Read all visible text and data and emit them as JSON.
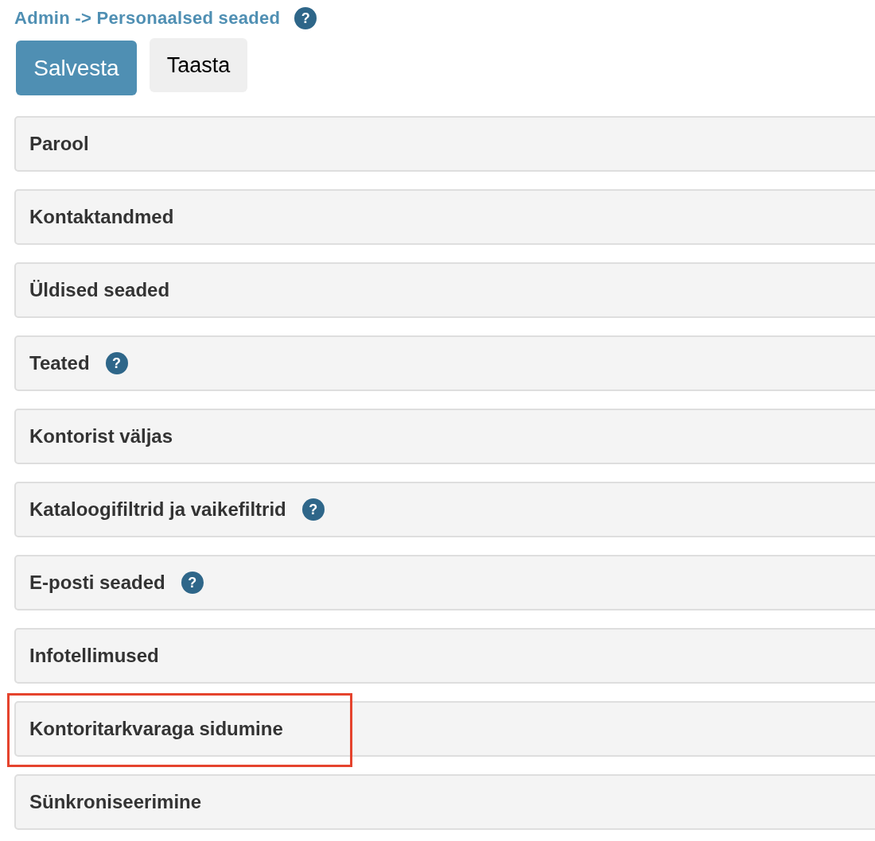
{
  "breadcrumb": {
    "text": "Admin -> Personaalsed seaded",
    "help_icon": "?"
  },
  "buttons": [
    {
      "label": "Salvesta",
      "kind": "primary"
    },
    {
      "label": "Taasta",
      "kind": "secondary"
    }
  ],
  "sections": [
    {
      "title": "Parool",
      "highlighted": false
    },
    {
      "title": "Kontaktandmed",
      "highlighted": false
    },
    {
      "title": "Üldised seaded",
      "highlighted": false
    },
    {
      "title": "Teated",
      "help_icon": "?",
      "highlighted": false
    },
    {
      "title": "Kontorist väljas",
      "highlighted": false
    },
    {
      "title": "Kataloogifiltrid ja vaikefiltrid",
      "help_icon": "?",
      "highlighted": false
    },
    {
      "title": "E-posti seaded",
      "help_icon": "?",
      "highlighted": false
    },
    {
      "title": "Infotellimused",
      "highlighted": false
    },
    {
      "title": "Kontoritarkvaraga sidumine",
      "highlighted": true
    },
    {
      "title": "Sünkroniseerimine",
      "highlighted": false
    }
  ]
}
